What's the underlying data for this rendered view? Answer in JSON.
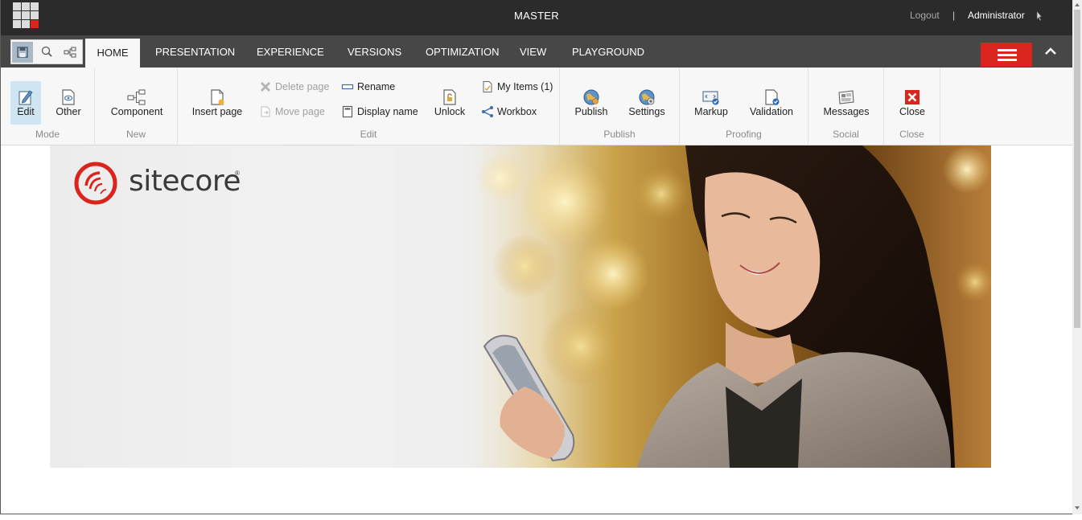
{
  "topbar": {
    "database": "MASTER",
    "logout_label": "Logout",
    "separator": "|",
    "user_name": "Administrator"
  },
  "quick_access": {
    "save_icon": "save-icon",
    "search_icon": "search-icon",
    "tree_icon": "navigation-tree-icon"
  },
  "tabs": [
    {
      "label": "HOME",
      "active": true
    },
    {
      "label": "PRESENTATION",
      "active": false
    },
    {
      "label": "EXPERIENCE",
      "active": false
    },
    {
      "label": "VERSIONS",
      "active": false
    },
    {
      "label": "OPTIMIZATION",
      "active": false
    },
    {
      "label": "VIEW",
      "active": false
    },
    {
      "label": "PLAYGROUND",
      "active": false
    }
  ],
  "ribbon": {
    "mode": {
      "group_label": "Mode",
      "edit_label": "Edit",
      "other_label": "Other"
    },
    "new": {
      "group_label": "New",
      "component_label": "Component"
    },
    "edit": {
      "group_label": "Edit",
      "insert_page_label": "Insert page",
      "delete_page_label": "Delete page",
      "move_page_label": "Move page",
      "rename_label": "Rename",
      "display_name_label": "Display name",
      "unlock_label": "Unlock",
      "my_items_label": "My Items (1)",
      "workbox_label": "Workbox"
    },
    "publish": {
      "group_label": "Publish",
      "publish_label": "Publish",
      "settings_label": "Settings"
    },
    "proofing": {
      "group_label": "Proofing",
      "markup_label": "Markup",
      "validation_label": "Validation"
    },
    "social": {
      "group_label": "Social",
      "messages_label": "Messages"
    },
    "close": {
      "group_label": "Close",
      "close_label": "Close"
    }
  },
  "content": {
    "logo_text": "sitecore"
  },
  "colors": {
    "topbar": "#2b2b2b",
    "tabstrip": "#474747",
    "accent_red": "#d9251d",
    "ribbon_bg": "#f7f7f7",
    "selected_button": "#cfe6f2"
  }
}
